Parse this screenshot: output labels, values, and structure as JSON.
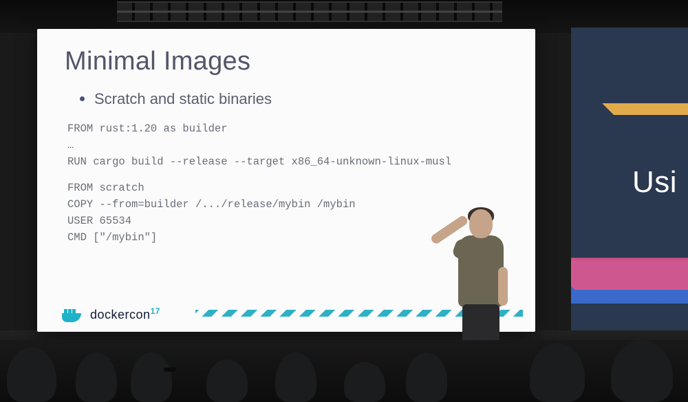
{
  "slide": {
    "title": "Minimal Images",
    "bullet": "Scratch and static binaries",
    "code_block_1": "FROM rust:1.20 as builder\n…\nRUN cargo build --release --target x86_64-unknown-linux-musl",
    "code_block_2": "FROM scratch\nCOPY --from=builder /.../release/mybin /mybin\nUSER 65534\nCMD [\"/mybin\"]",
    "footer_brand": "dockercon",
    "footer_year": "17"
  },
  "side_banner": {
    "partial_text": "Usi"
  }
}
